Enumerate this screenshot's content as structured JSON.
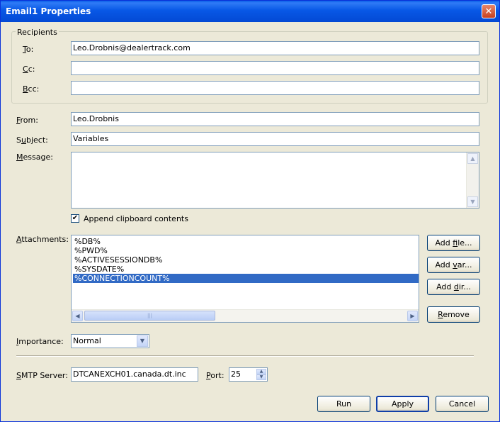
{
  "window": {
    "title": "Email1 Properties",
    "close_glyph": "✕"
  },
  "recipients": {
    "group_label": "Recipients",
    "to": {
      "label_key": "T",
      "label_rest": "o:",
      "value": "Leo.Drobnis@dealertrack.com"
    },
    "cc": {
      "label_key": "C",
      "label_rest": "c:",
      "value": ""
    },
    "bcc": {
      "label_key": "B",
      "label_rest": "cc:",
      "value": ""
    }
  },
  "from": {
    "label_key": "F",
    "label_rest": "rom:",
    "value": "Leo.Drobnis"
  },
  "subject": {
    "label_pre": "S",
    "label_key": "u",
    "label_rest": "bject:",
    "value": "Variables"
  },
  "message": {
    "label_key": "M",
    "label_rest": "essage:",
    "value": ""
  },
  "append": {
    "label": "Append clipboard contents",
    "checked": true,
    "check_glyph": "✔"
  },
  "attachments": {
    "label_key": "A",
    "label_rest": "ttachments:",
    "items": [
      "%DB%",
      "%PWD%",
      "%ACTIVESESSIONDB%",
      "%SYSDATE%",
      "%CONNECTIONCOUNT%"
    ],
    "selected_index": 4,
    "buttons": {
      "add_file": {
        "pre": "Add ",
        "key": "f",
        "rest": "ile..."
      },
      "add_var": {
        "pre": "Add ",
        "key": "v",
        "rest": "ar..."
      },
      "add_dir": {
        "pre": "Add ",
        "key": "d",
        "rest": "ir..."
      },
      "remove": {
        "pre": "",
        "key": "R",
        "rest": "emove"
      }
    }
  },
  "importance": {
    "label_key": "I",
    "label_rest": "mportance:",
    "value": "Normal"
  },
  "smtp": {
    "label_key": "S",
    "label_rest": "MTP Server:",
    "value": "DTCANEXCH01.canada.dt.inc"
  },
  "port": {
    "label_key": "P",
    "label_rest": "ort:",
    "value": "25"
  },
  "footer": {
    "run": "Run",
    "apply": "Apply",
    "cancel": "Cancel"
  },
  "colors": {
    "title_bar": "#0858e6",
    "selection": "#316ac5",
    "dialog_bg": "#ece9d8"
  },
  "icons": {
    "close": "close-icon",
    "scroll_up": "scroll-up-arrow-icon",
    "scroll_down": "scroll-down-arrow-icon",
    "scroll_left": "scroll-left-arrow-icon",
    "scroll_right": "scroll-right-arrow-icon",
    "dropdown": "dropdown-arrow-icon",
    "spin_up": "spin-up-icon",
    "spin_down": "spin-down-icon"
  }
}
